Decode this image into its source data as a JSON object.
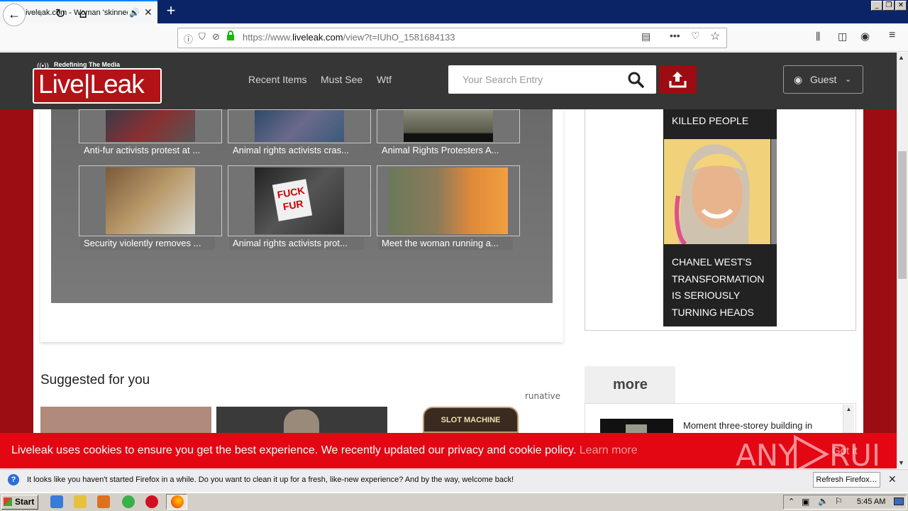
{
  "browser": {
    "tab_title": "Liveleak.com - Woman 'skinned",
    "tab_favicon": "LL",
    "url_prefix": "https://www.",
    "url_domain": "liveleak.com",
    "url_rest": "/view?t=IUhO_1581684133",
    "url_action_icons": [
      "reader-view-icon",
      "more-actions-icon",
      "pocket-icon",
      "bookmark-star-icon"
    ],
    "toolbar_icons": [
      "library-icon",
      "sidebar-icon",
      "account-icon",
      "menu-icon"
    ]
  },
  "site": {
    "tagline": "Redefining The Media",
    "logo_text_1": "Live",
    "logo_text_2": "Leak",
    "nav": [
      "Recent Items",
      "Must See",
      "Wtf"
    ],
    "search_placeholder": "Your Search Entry",
    "guest_label": "Guest"
  },
  "related_videos": [
    {
      "caption": "Anti-fur activists protest at ..."
    },
    {
      "caption": "Animal rights activists cras..."
    },
    {
      "caption": "Animal Rights Protesters A..."
    },
    {
      "caption": "Security violently removes ..."
    },
    {
      "caption": "Animal rights activists prot..."
    },
    {
      "caption": "Meet the woman running a..."
    }
  ],
  "thumb_sign_text_1": "FUCK",
  "thumb_sign_text_2": "FUR",
  "suggested": {
    "heading": "Suggested for you",
    "provider": "runative",
    "slot_label": "SLOT MACHINE"
  },
  "ad": {
    "top_text": "KILLED PEOPLE",
    "caption": "CHANEL WEST'S TRANSFORMATION IS SERIOUSLY TURNING HEADS"
  },
  "more": {
    "tab_label": "more",
    "items": [
      "Moment three-storey building in"
    ]
  },
  "cookie_banner": {
    "text": "Liveleak uses cookies to ensure you get the best experience. We recently updated our privacy and cookie policy.",
    "link": "Learn more",
    "button": "Got it"
  },
  "watermark": "ANY RUN",
  "notification": {
    "text": "It looks like you haven't started Firefox in a while. Do you want to clean it up for a fresh, like-new experience? And by the way, welcome back!",
    "button": "Refresh Firefox…"
  },
  "taskbar": {
    "start": "Start",
    "clock": "5:45 AM"
  }
}
